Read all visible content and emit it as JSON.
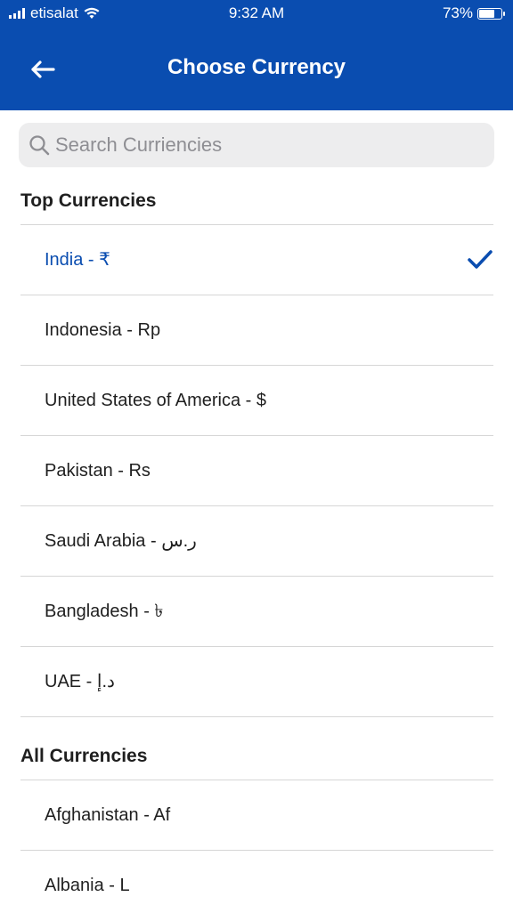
{
  "status_bar": {
    "carrier": "etisalat",
    "time": "9:32 AM",
    "battery": "73%",
    "battery_level": 0.73
  },
  "header": {
    "title": "Choose Currency",
    "back_icon": "arrow-left-icon"
  },
  "search": {
    "placeholder": "Search Curriencies",
    "value": ""
  },
  "top_section": {
    "title": "Top Currencies",
    "items": [
      {
        "label": "India - ₹",
        "selected": true
      },
      {
        "label": "Indonesia - Rp",
        "selected": false
      },
      {
        "label": "United States of America - $",
        "selected": false
      },
      {
        "label": "Pakistan - Rs",
        "selected": false
      },
      {
        "label": "Saudi Arabia - ر.س",
        "selected": false
      },
      {
        "label": "Bangladesh - ৳",
        "selected": false
      },
      {
        "label": "UAE - د.إ",
        "selected": false
      }
    ]
  },
  "all_section": {
    "title": "All Currencies",
    "items": [
      {
        "label": "Afghanistan - Af",
        "selected": false
      },
      {
        "label": "Albania - L",
        "selected": false
      }
    ]
  },
  "colors": {
    "brand": "#0a4db0",
    "selected_text": "#0a4db0"
  }
}
